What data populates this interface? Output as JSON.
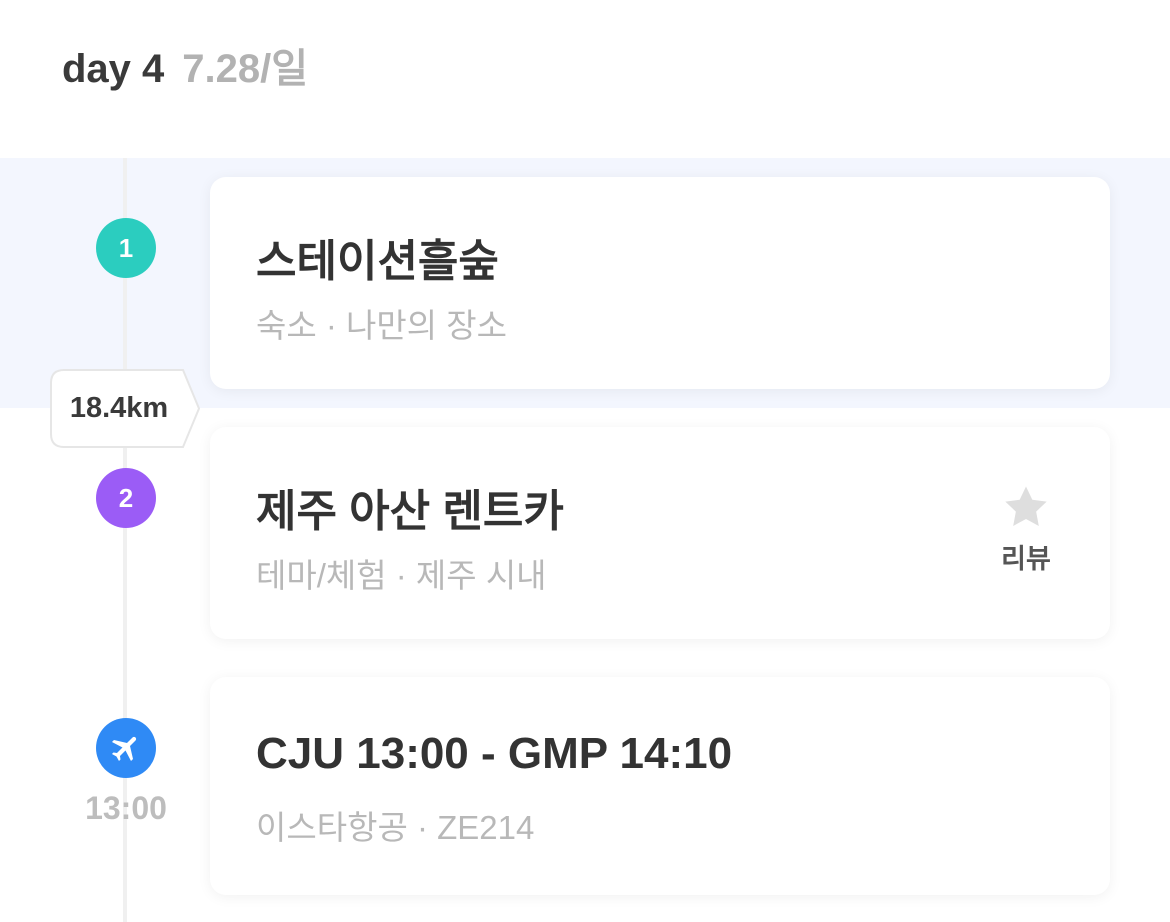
{
  "header": {
    "day": "day 4",
    "date": "7.28/일"
  },
  "colors": {
    "accent_teal": "#2bcdbf",
    "accent_purple": "#9b5cf6",
    "accent_blue": "#2f8af5",
    "highlight_band": "#f3f6fe"
  },
  "distance": "18.4km",
  "items": [
    {
      "number": "1",
      "title": "스테이션흘숲",
      "subtitle": "숙소 · 나만의 장소"
    },
    {
      "number": "2",
      "title": "제주 아산 렌트카",
      "subtitle": "테마/체험 · 제주 시내",
      "review_icon": "star-icon",
      "review_label": "리뷰"
    },
    {
      "icon": "airplane-icon",
      "time": "13:00",
      "title": "CJU 13:00 - GMP 14:10",
      "subtitle": "이스타항공 · ZE214"
    }
  ]
}
